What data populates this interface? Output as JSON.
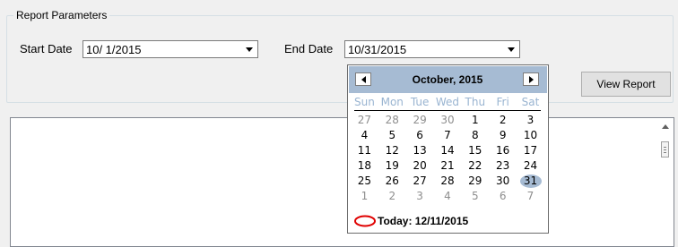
{
  "report_parameters": {
    "legend": "Report Parameters",
    "start_date_label": "Start Date",
    "start_date_value": "10/ 1/2015",
    "end_date_label": "End Date",
    "end_date_value": "10/31/2015",
    "view_report_label": "View Report"
  },
  "calendar": {
    "month_title": "October, 2015",
    "prev_icon": "triangle-left",
    "next_icon": "triangle-right",
    "weekdays": [
      "Sun",
      "Mon",
      "Tue",
      "Wed",
      "Thu",
      "Fri",
      "Sat"
    ],
    "weeks": [
      [
        "27",
        "28",
        "29",
        "30",
        "1",
        "2",
        "3"
      ],
      [
        "4",
        "5",
        "6",
        "7",
        "8",
        "9",
        "10"
      ],
      [
        "11",
        "12",
        "13",
        "14",
        "15",
        "16",
        "17"
      ],
      [
        "18",
        "19",
        "20",
        "21",
        "22",
        "23",
        "24"
      ],
      [
        "25",
        "26",
        "27",
        "28",
        "29",
        "30",
        "31"
      ],
      [
        "1",
        "2",
        "3",
        "4",
        "5",
        "6",
        "7"
      ]
    ],
    "selected_day": "31",
    "today_label": "Today: 12/11/2015",
    "today_marker_color": "#e00000",
    "selection_color": "#a6bbd3"
  }
}
